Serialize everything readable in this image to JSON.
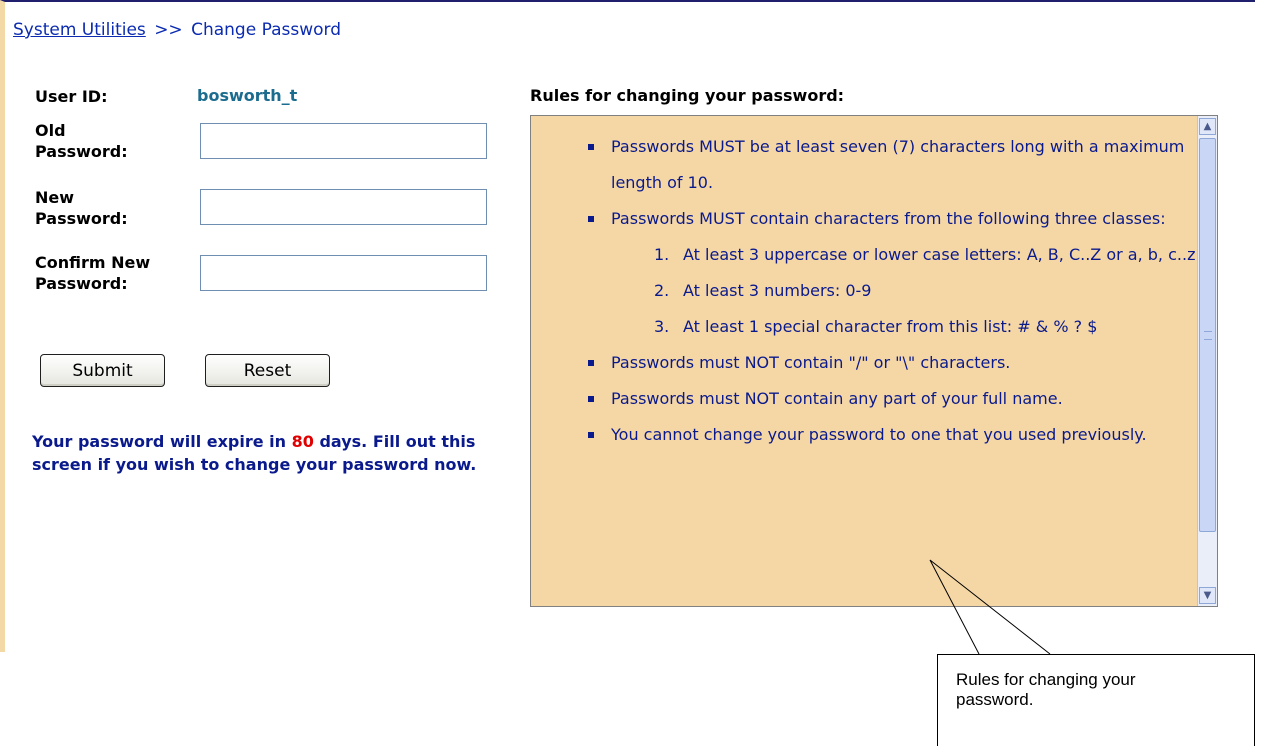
{
  "breadcrumb": {
    "link": "System Utilities",
    "separator": ">>",
    "current": "Change Password"
  },
  "form": {
    "user_id_label": "User ID:",
    "user_id_value": "bosworth_t",
    "old_password_label": "Old Password:",
    "old_password_value": "",
    "new_password_label": "New Password:",
    "new_password_value": "",
    "confirm_password_label": "Confirm New Password:",
    "confirm_password_value": "",
    "submit_label": "Submit",
    "reset_label": "Reset"
  },
  "expiry": {
    "prefix": "Your password will expire in ",
    "days": "80",
    "suffix": " days.  Fill out this screen if you wish to change your password now."
  },
  "rules": {
    "title": "Rules for changing your password:",
    "items": [
      "Passwords MUST be at least seven (7) characters long with a maximum length of 10.",
      "Passwords MUST contain characters from the following three classes:",
      "Passwords must NOT contain \"/\" or \"\\\" characters.",
      "Passwords must NOT contain any part of your full name.",
      "You cannot change your password to one that you used previously."
    ],
    "subitems": [
      {
        "num": "1.",
        "text": "At least 3 uppercase or lower case letters: A, B, C..Z or a, b, c..z"
      },
      {
        "num": "2.",
        "text": "At least 3 numbers: 0-9"
      },
      {
        "num": "3.",
        "text": "At least 1 special character from this list: # & % ? $"
      }
    ]
  },
  "callout": {
    "text": "Rules for changing your password."
  },
  "colors": {
    "link": "#0b2bb0",
    "user_id": "#1b6c8e",
    "message": "#0a1a8c",
    "days": "#e00000",
    "rules_background": "#f5d7a6"
  },
  "icons": {
    "scroll_up": "scroll-up-arrow-icon",
    "scroll_down": "scroll-down-arrow-icon"
  }
}
